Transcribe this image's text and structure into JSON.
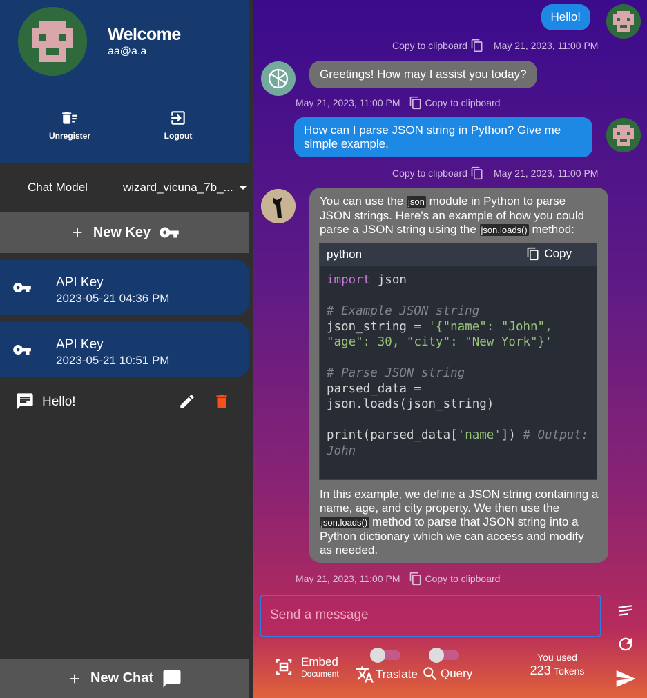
{
  "profile": {
    "title": "Welcome",
    "email": "aa@a.a",
    "unregister": "Unregister",
    "logout": "Logout"
  },
  "model": {
    "label": "Chat Model",
    "value": "wizard_vicuna_7b_..."
  },
  "new_key": "New Key",
  "keys": [
    {
      "title": "API Key",
      "date": "2023-05-21 04:36 PM"
    },
    {
      "title": "API Key",
      "date": "2023-05-21 10:51 PM"
    }
  ],
  "chats": [
    {
      "title": "Hello!"
    }
  ],
  "new_chat": "New Chat",
  "copy_label": "Copy to clipboard",
  "timestamp": "May 21, 2023, 11:00 PM",
  "messages": {
    "u1": "Hello!",
    "a1": "Greetings! How may I assist you today?",
    "u2": "How can I parse JSON string in Python? Give me simple example.",
    "a2_p1_a": "You can use the",
    "a2_code1": "json",
    "a2_p1_b": "module in Python to parse JSON strings. Here's an example of how you could parse a JSON string using the",
    "a2_code2": "json.loads()",
    "a2_p1_c": "method:",
    "code_lang": "python",
    "code_copy": "Copy",
    "a2_p2_a": "In this example, we define a JSON string containing a name, age, and city property. We then use the",
    "a2_p2_b": "method to parse that JSON string into a Python dictionary which we can access and modify as needed."
  },
  "input": {
    "placeholder": "Send a message"
  },
  "bottom": {
    "embed": "Embed",
    "embed_sub": "Document",
    "translate": "Traslate",
    "query": "Query",
    "used": "You used",
    "tokens_count": "223",
    "tokens_label": "Tokens"
  },
  "colors": {
    "sidebar": "#2f2f2f",
    "profile": "#16396e",
    "user_bubble": "#1e88e5",
    "assistant_bubble": "#6f6f6f",
    "accent": "#2f7de1",
    "delete": "#f4511e"
  }
}
